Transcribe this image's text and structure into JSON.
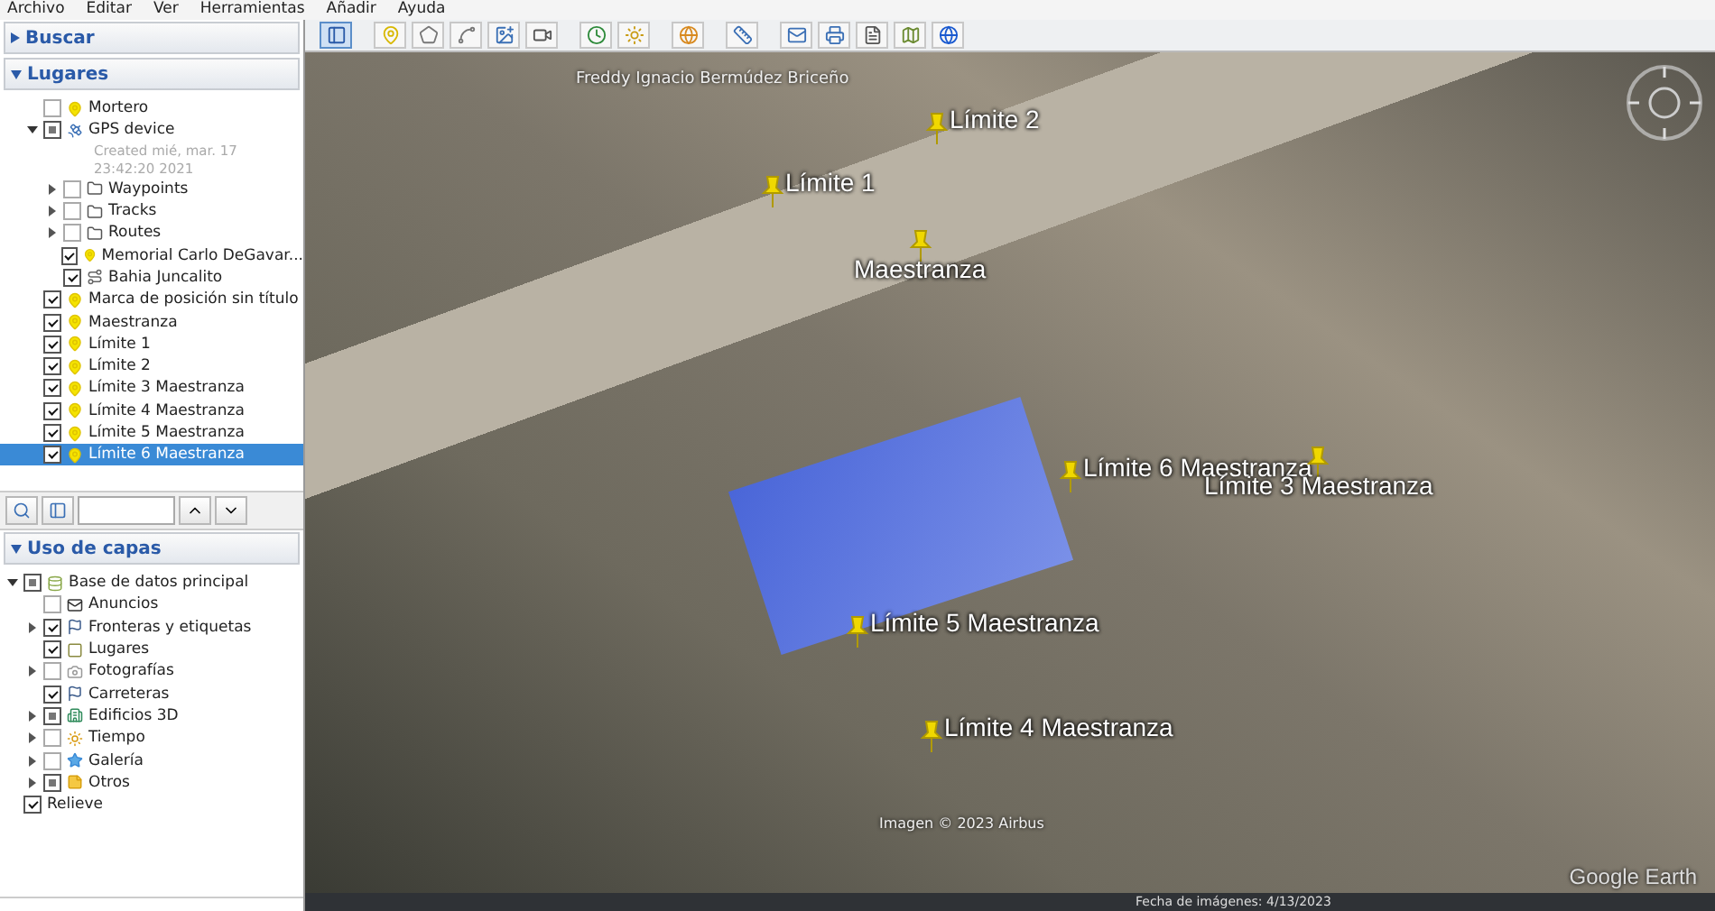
{
  "menu": [
    "Archivo",
    "Editar",
    "Ver",
    "Herramientas",
    "Añadir",
    "Ayuda"
  ],
  "search_panel": {
    "title": "Buscar",
    "expanded": false
  },
  "places_panel": {
    "title": "Lugares",
    "expanded": true,
    "items": [
      {
        "label": "Mortero",
        "kind": "placemark",
        "checked": false,
        "mixed": false,
        "selected": false
      },
      {
        "label": "GPS device",
        "kind": "gps",
        "checked": true,
        "mixed": true,
        "expanded": true,
        "selected": false,
        "children": [
          {
            "label": "Created mié, mar. 17 23:42:20 2021",
            "kind": "description"
          },
          {
            "label": "Waypoints",
            "kind": "folder",
            "checked": false,
            "mixed": false,
            "expanded": false,
            "selected": false
          },
          {
            "label": "Tracks",
            "kind": "folder",
            "checked": false,
            "mixed": false,
            "expanded": false,
            "selected": false
          },
          {
            "label": "Routes",
            "kind": "folder",
            "checked": false,
            "mixed": false,
            "expanded": false,
            "selected": false
          },
          {
            "label": "Memorial Carlo DeGavar...",
            "kind": "placemark",
            "checked": true,
            "mixed": false,
            "selected": false
          },
          {
            "label": "Bahia Juncalito",
            "kind": "path",
            "checked": true,
            "mixed": false,
            "selected": false
          }
        ]
      },
      {
        "label": "Marca de posición sin título",
        "kind": "placemark",
        "checked": true,
        "mixed": false,
        "selected": false
      },
      {
        "label": "Maestranza",
        "kind": "placemark",
        "checked": true,
        "mixed": false,
        "selected": false
      },
      {
        "label": "Límite 1",
        "kind": "placemark",
        "checked": true,
        "mixed": false,
        "selected": false
      },
      {
        "label": "Límite 2",
        "kind": "placemark",
        "checked": true,
        "mixed": false,
        "selected": false
      },
      {
        "label": "Límite 3 Maestranza",
        "kind": "placemark",
        "checked": true,
        "mixed": false,
        "selected": false
      },
      {
        "label": "Límite 4 Maestranza",
        "kind": "placemark",
        "checked": true,
        "mixed": false,
        "selected": false
      },
      {
        "label": "Límite 5 Maestranza",
        "kind": "placemark",
        "checked": true,
        "mixed": false,
        "selected": false
      },
      {
        "label": "Límite 6 Maestranza",
        "kind": "placemark",
        "checked": true,
        "mixed": false,
        "selected": true
      }
    ]
  },
  "layers_panel": {
    "title": "Uso de capas",
    "expanded": true,
    "items": [
      {
        "label": "Base de datos principal",
        "kind": "database",
        "checked": true,
        "mixed": true,
        "expanded": true,
        "children": [
          {
            "label": "Anuncios",
            "kind": "mail",
            "checked": false,
            "mixed": false
          },
          {
            "label": "Fronteras y etiquetas",
            "kind": "flag",
            "checked": true,
            "mixed": false,
            "expanded": false
          },
          {
            "label": "Lugares",
            "kind": "square",
            "checked": true,
            "mixed": false
          },
          {
            "label": "Fotografías",
            "kind": "photo",
            "checked": false,
            "mixed": false,
            "expanded": false
          },
          {
            "label": "Carreteras",
            "kind": "flag",
            "checked": true,
            "mixed": false
          },
          {
            "label": "Edificios 3D",
            "kind": "building",
            "checked": true,
            "mixed": true,
            "expanded": false
          },
          {
            "label": "Tiempo",
            "kind": "sun",
            "checked": false,
            "mixed": false,
            "expanded": false
          },
          {
            "label": "Galería",
            "kind": "star",
            "checked": false,
            "mixed": false,
            "expanded": false
          },
          {
            "label": "Otros",
            "kind": "note",
            "checked": true,
            "mixed": true,
            "expanded": false
          }
        ]
      },
      {
        "label": "Relieve",
        "kind": "plain",
        "checked": true,
        "mixed": false
      }
    ]
  },
  "map": {
    "street_label": "Freddy Ignacio Bermúdez Briceño",
    "placemarks": [
      {
        "label": "Límite 2"
      },
      {
        "label": "Límite 1"
      },
      {
        "label": "Maestranza"
      },
      {
        "label": "Límite 6 Maestranza"
      },
      {
        "label": "Límite 3 Maestranza"
      },
      {
        "label": "Límite 5 Maestranza"
      },
      {
        "label": "Límite 4 Maestranza"
      }
    ],
    "attribution": "Imagen © 2023 Airbus",
    "logo": "Google Earth"
  },
  "status_bar": {
    "imagery_date": "Fecha de imágenes: 4/13/2023"
  }
}
